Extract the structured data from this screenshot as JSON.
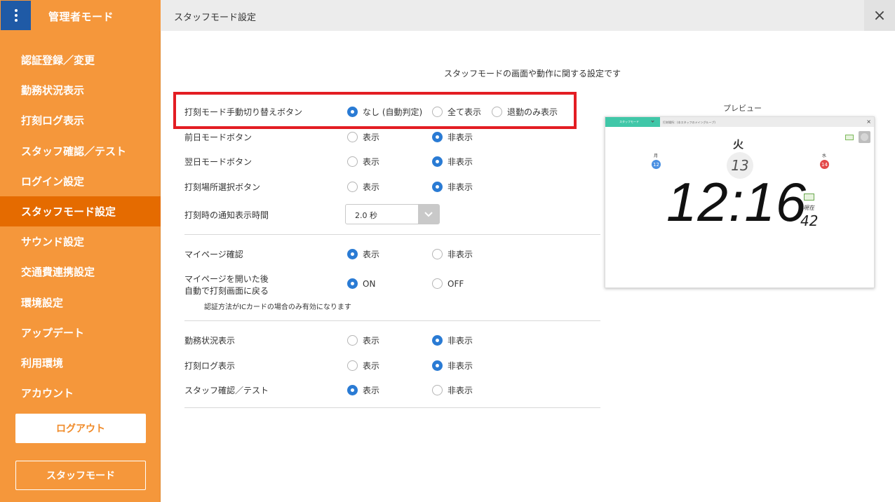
{
  "sidebar": {
    "title": "管理者モード",
    "items": [
      {
        "label": "認証登録／変更",
        "active": false
      },
      {
        "label": "勤務状況表示",
        "active": false
      },
      {
        "label": "打刻ログ表示",
        "active": false
      },
      {
        "label": "スタッフ確認／テスト",
        "active": false
      },
      {
        "label": "ログイン設定",
        "active": false
      },
      {
        "label": "スタッフモード設定",
        "active": true
      },
      {
        "label": "サウンド設定",
        "active": false
      },
      {
        "label": "交通費連携設定",
        "active": false
      },
      {
        "label": "環境設定",
        "active": false
      },
      {
        "label": "アップデート",
        "active": false
      },
      {
        "label": "利用環境",
        "active": false
      },
      {
        "label": "アカウント",
        "active": false
      }
    ],
    "logout_label": "ログアウト",
    "staff_mode_label": "スタッフモード"
  },
  "header": {
    "title": "スタッフモード設定",
    "close_icon": "×"
  },
  "description": "スタッフモードの画面や動作に関する設定です",
  "settings": {
    "manual_switch": {
      "label": "打刻モード手動切り替えボタン",
      "options": [
        "なし (自動判定)",
        "全て表示",
        "退勤のみ表示"
      ],
      "selected": 0
    },
    "prev_day": {
      "label": "前日モードボタン",
      "options": [
        "表示",
        "非表示"
      ],
      "selected": 1
    },
    "next_day": {
      "label": "翌日モードボタン",
      "options": [
        "表示",
        "非表示"
      ],
      "selected": 1
    },
    "location_select": {
      "label": "打刻場所選択ボタン",
      "options": [
        "表示",
        "非表示"
      ],
      "selected": 1
    },
    "notify_time": {
      "label": "打刻時の通知表示時間",
      "value": "2.0 秒"
    },
    "mypage": {
      "label": "マイページ確認",
      "options": [
        "表示",
        "非表示"
      ],
      "selected": 0
    },
    "mypage_return": {
      "label_line1": "マイページを開いた後",
      "label_line2": "自動で打刻画面に戻る",
      "options": [
        "ON",
        "OFF"
      ],
      "selected": 0,
      "note": "認証方法がICカードの場合のみ有効になります"
    },
    "work_status": {
      "label": "勤務状況表示",
      "options": [
        "表示",
        "非表示"
      ],
      "selected": 1
    },
    "punch_log": {
      "label": "打刻ログ表示",
      "options": [
        "表示",
        "非表示"
      ],
      "selected": 1
    },
    "staff_check": {
      "label": "スタッフ確認／テスト",
      "options": [
        "表示",
        "非表示"
      ],
      "selected": 0
    }
  },
  "preview": {
    "title": "プレビュー",
    "tab_label": "スタッフモード",
    "location_text": "打刻場所：(本スタッフのメイングループ)",
    "close_icon": "×",
    "weekday": "火",
    "day": "13",
    "prev_weekday": "月",
    "prev_day": "12",
    "next_weekday": "水",
    "next_day": "14",
    "time": "12:16",
    "now_label": "現在",
    "seconds": "42",
    "accent_color": "#40c7a8"
  },
  "colors": {
    "sidebar": "#f5973b",
    "active": "#e56b00",
    "radio": "#2a7bd4",
    "highlight": "#e31d23"
  }
}
